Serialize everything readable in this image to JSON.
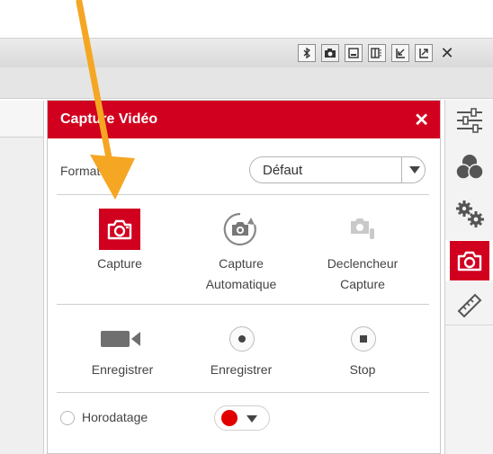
{
  "toolbar": {
    "buttons": [
      {
        "icon": "bluetooth-icon",
        "glyph": "✻"
      },
      {
        "icon": "camera-icon",
        "glyph": "◙"
      },
      {
        "icon": "minimize-icon",
        "glyph": "▭"
      },
      {
        "icon": "split-view-icon",
        "glyph": "◫"
      },
      {
        "icon": "dock-arrow-icon",
        "glyph": "⇲"
      },
      {
        "icon": "undock-arrow-icon",
        "glyph": "⇗"
      },
      {
        "icon": "close-icon",
        "glyph": "✕"
      }
    ]
  },
  "dialog": {
    "title": "Capture Vidéo",
    "close_glyph": "✕",
    "format_label": "Format",
    "format_value": "Défaut",
    "capture_items": [
      {
        "label": "Capture",
        "icon": "camera-icon",
        "active": true
      },
      {
        "label_line1": "Capture",
        "label_line2": "Automatique",
        "icon": "auto-capture-icon"
      },
      {
        "label_line1": "Declencheur",
        "label_line2": "Capture",
        "icon": "trigger-capture-icon",
        "disabled": true
      }
    ],
    "record_items": [
      {
        "label": "Enregistrer",
        "icon": "video-camera-icon"
      },
      {
        "label": "Enregistrer",
        "icon": "record-dot-icon"
      },
      {
        "label": "Stop",
        "icon": "stop-icon"
      }
    ],
    "timestamp_label": "Horodatage",
    "color_value": "#e00000"
  },
  "colors": {
    "accent": "#d1001f",
    "arrow": "#f5a623"
  },
  "rightbar": {
    "items": [
      "sliders-icon",
      "color-circles-icon",
      "gears-icon",
      "camera-icon",
      "ruler-icon"
    ]
  }
}
